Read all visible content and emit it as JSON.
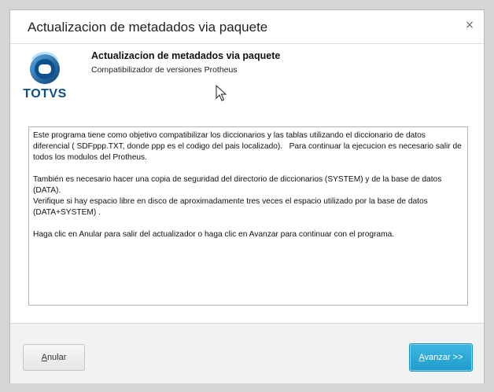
{
  "window": {
    "title": "Actualizacion de metadados via paquete",
    "close_glyph": "×"
  },
  "header": {
    "logo_text": "TOTVS",
    "title": "Actualizacion de metadados via paquete",
    "subtitle": "Compatibilizador de versiones Protheus"
  },
  "body": {
    "paragraphs": [
      "Este programa tiene como objetivo compatibilizar los diccionarios y las tablas utilizando el diccionario de datos diferencial ( SDFppp.TXT, donde ppp es el codigo del pais localizado).   Para continuar la ejecucion es necesario salir de todos los modulos del Protheus.",
      "También es necesario hacer una copia de seguridad del directorio de diccionarios (SYSTEM) y de la base de datos (DATA).",
      "Verifique si hay espacio libre en disco de aproximadamente tres veces el espacio utilizado por la base de datos (DATA+SYSTEM) .",
      "Haga clic en Anular para salir del actualizador o haga clic en Avanzar para continuar con el programa."
    ]
  },
  "footer": {
    "cancel_label": "Anular",
    "next_label": "Avanzar >>"
  },
  "colors": {
    "accent": "#1e9ccd",
    "logo_blue": "#0b4f8a"
  },
  "icons": {
    "close": "close-icon",
    "logo": "totvs-logo-icon",
    "cursor": "mouse-pointer-icon"
  }
}
